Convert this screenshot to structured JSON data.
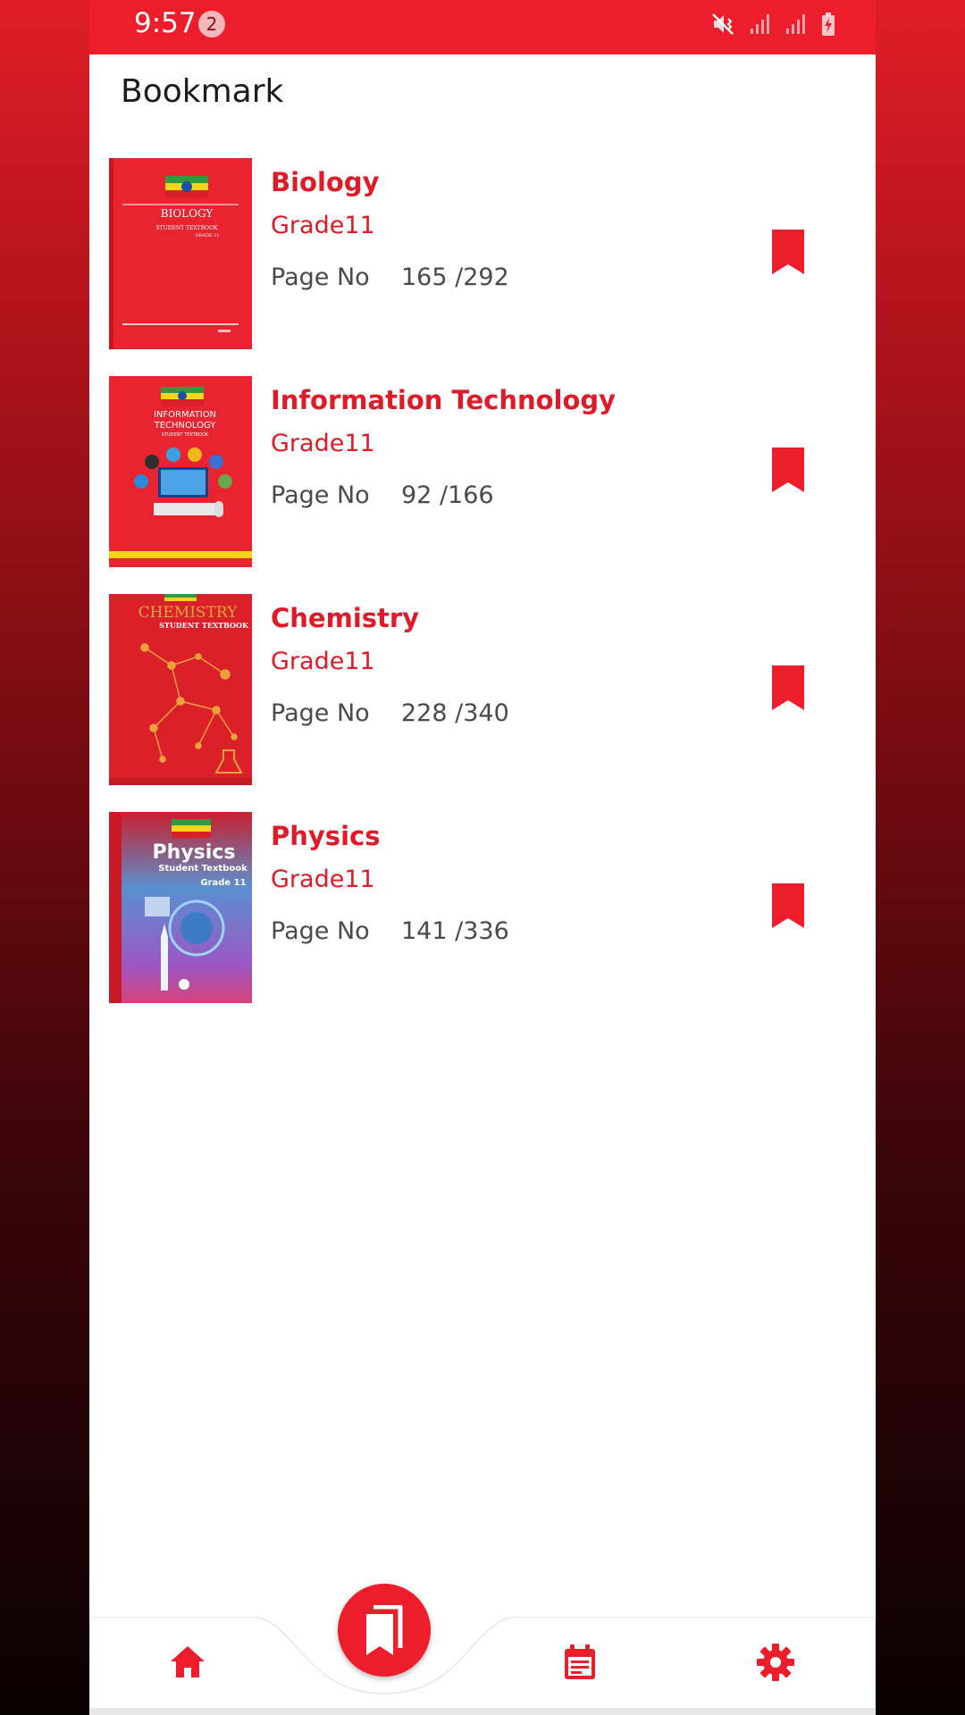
{
  "status_bar": {
    "time": "9:57",
    "notification_count": "2",
    "icons": [
      "mute-vibrate-icon",
      "signal-icon",
      "signal-icon",
      "battery-charging-icon"
    ]
  },
  "page": {
    "title": "Bookmark"
  },
  "bookmarks": [
    {
      "title": "Biology",
      "grade": "Grade11",
      "page_label": "Page No",
      "page_value": "165 /292",
      "cover_icon": "biology-cover-image"
    },
    {
      "title": "Information Technology",
      "grade": "Grade11",
      "page_label": "Page No",
      "page_value": "92 /166",
      "cover_icon": "it-cover-image"
    },
    {
      "title": "Chemistry",
      "grade": "Grade11",
      "page_label": "Page No",
      "page_value": "228 /340",
      "cover_icon": "chemistry-cover-image"
    },
    {
      "title": "Physics",
      "grade": "Grade11",
      "page_label": "Page No",
      "page_value": "141 /336",
      "cover_icon": "physics-cover-image"
    }
  ],
  "covers": {
    "biology_title": "BIOLOGY",
    "biology_sub": "STUDENT TEXTBOOK",
    "biology_grade": "GRADE 11",
    "it_title_1": "INFORMATION",
    "it_title_2": "TECHNOLOGY",
    "it_sub": "STUDENT TEXTBOOK",
    "chem_title": "CHEMISTRY",
    "chem_sub": "STUDENT TEXTBOOK",
    "physics_title": "Physics",
    "physics_sub": "Student Textbook",
    "physics_grade": "Grade 11"
  },
  "bottom_nav": {
    "items": [
      "home-icon",
      "bookmark-icon",
      "calendar-icon",
      "settings-icon"
    ],
    "active": "bookmark-icon"
  },
  "colors": {
    "accent": "#ee1d2b",
    "text_dark": "#1c1c1c",
    "text_grey": "#4a4a4a"
  }
}
